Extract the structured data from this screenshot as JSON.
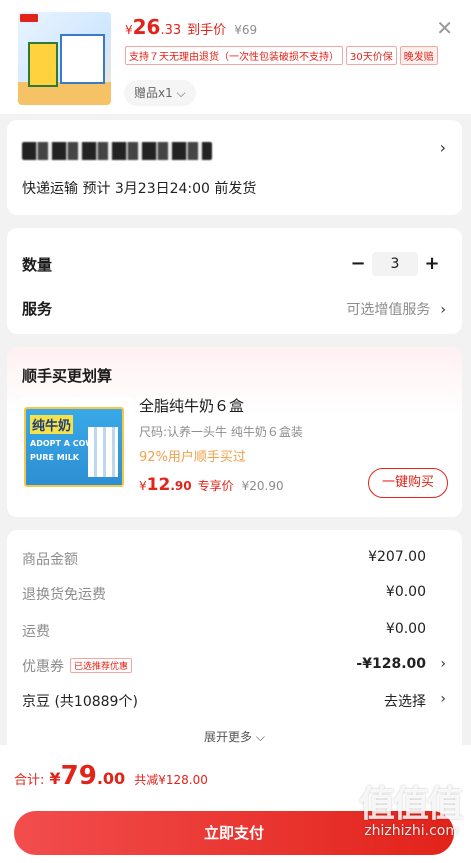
{
  "product": {
    "price_yen": "¥",
    "price_int": "26",
    "price_dec": ".33",
    "price_label": "到手价",
    "orig_price": "¥69",
    "tags": [
      "支持７天无理由退货（一次性包装破损不支持）",
      "30天价保",
      "晚发赔"
    ],
    "gift_label": "赠品x1 ⌵"
  },
  "address": {
    "shipping": "快递运输  预计 3月23日24:00 前发货"
  },
  "quantity": {
    "label": "数量",
    "minus": "−",
    "value": "3",
    "plus": "+"
  },
  "service": {
    "label": "服务",
    "value": "可选增值服务"
  },
  "upsell": {
    "title": "顺手买更划算",
    "name": "全脂纯牛奶６盒",
    "spec": "尺码:认养一头牛  纯牛奶６盒装",
    "percent": "92%用户顺手买过",
    "price_yen": "¥",
    "price_int": "12",
    "price_dec": ".90",
    "price_label": "专享价",
    "orig_price": "¥20.90",
    "buy_label": "一键购买",
    "thumb_title": "纯牛奶",
    "thumb_line1": "ADOPT A COW",
    "thumb_line2": "PURE MILK"
  },
  "summary": {
    "rows": [
      {
        "label": "商品金额",
        "value": "¥207.00"
      },
      {
        "label": "退换货免运费",
        "value": "¥0.00"
      },
      {
        "label": "运费",
        "value": "¥0.00"
      },
      {
        "label": "优惠券",
        "tag": "已选推荐优惠",
        "value": "-¥128.00"
      },
      {
        "label": "京豆 (共10889个)",
        "value": "去选择"
      }
    ],
    "expand": "展开更多 ⌵"
  },
  "bottom": {
    "total_label": "合计:",
    "total_yen": "¥",
    "total_int": "79",
    "total_dec": ".00",
    "saved": "共减¥128.00",
    "pay_label": "立即支付",
    "watermark": "值值值",
    "watermark_url": "zhizhizhi.com"
  },
  "colors": {
    "accent": "#e2231a",
    "orange": "#f0a14a"
  }
}
